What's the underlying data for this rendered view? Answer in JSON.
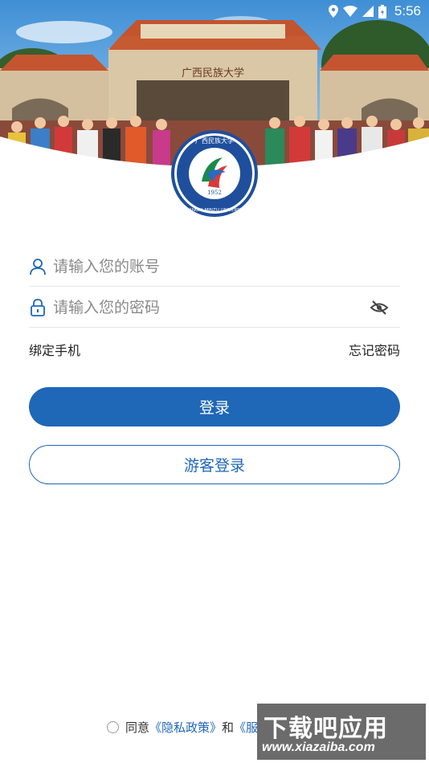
{
  "status_bar": {
    "time": "5:56",
    "icons": [
      "location-icon",
      "wifi-icon",
      "signal-icon",
      "battery-icon"
    ]
  },
  "header": {
    "gate_sign": "广西民族大学",
    "image": "campus-gate-photo"
  },
  "logo": {
    "name_en": "GUANGXI MINZU UNIVERSITY",
    "year": "1952",
    "name_cn": "广西民族大学"
  },
  "login_form": {
    "account_placeholder": "请输入您的账号",
    "password_placeholder": "请输入您的密码",
    "bind_phone": "绑定手机",
    "forgot_password": "忘记密码",
    "login_button": "登录",
    "guest_button": "游客登录"
  },
  "agreement": {
    "prefix": "同意",
    "privacy_link": "《隐私政策》",
    "and": "和",
    "terms_link": "《服务…"
  },
  "watermark": {
    "title": "下载吧应用",
    "url": "www.xiazaiba.com"
  },
  "colors": {
    "primary": "#1f67b7",
    "text": "#222222",
    "placeholder": "#8a8a8a",
    "divider": "#e6e6e6"
  }
}
